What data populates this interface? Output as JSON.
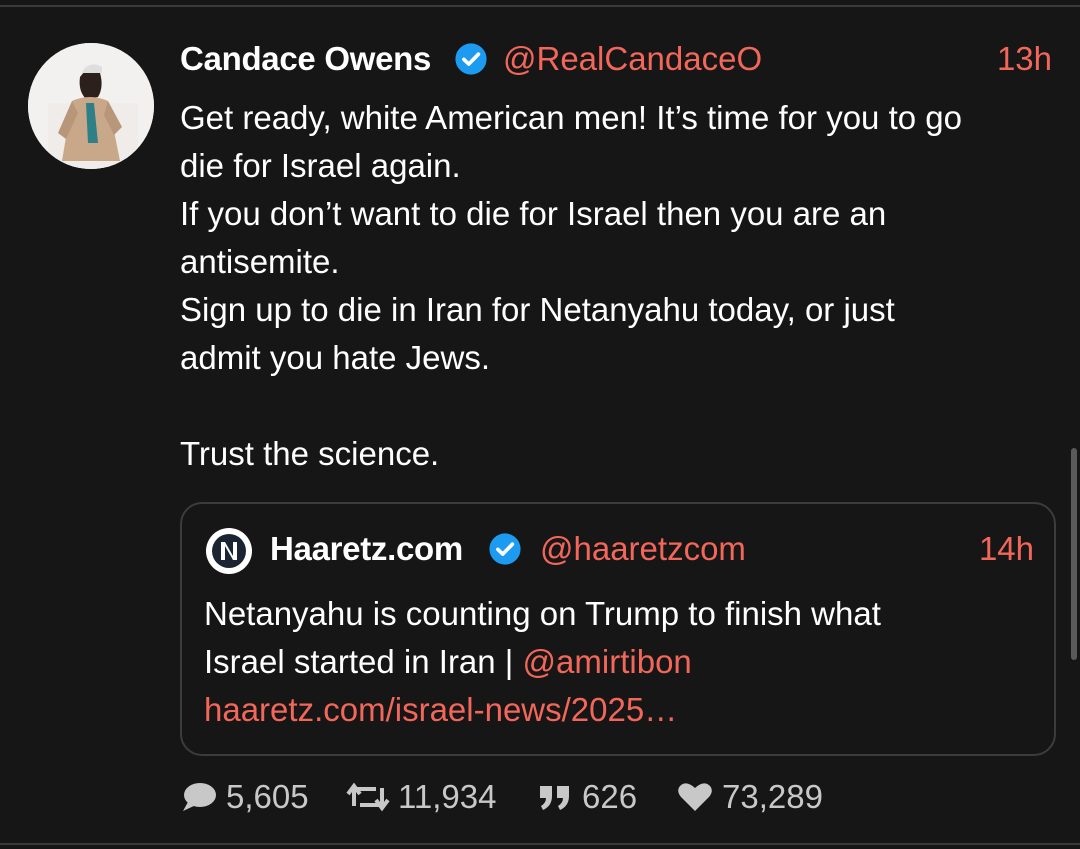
{
  "tweet": {
    "author_name": "Candace Owens",
    "handle": "@RealCandaceO",
    "time": "13h",
    "lines": [
      "Get ready, white American men! It’s time for you to go",
      "die for Israel again.",
      "If you don’t want to die for Israel then you are an",
      "antisemite.",
      "Sign up to die in Iran for Netanyahu today, or just",
      "admit you hate Jews.",
      "",
      "Trust the science."
    ]
  },
  "quote": {
    "author_name": "Haaretz.com",
    "handle": "@haaretzcom",
    "time": "14h",
    "line1": "Netanyahu is counting on Trump to finish what",
    "line2_text": "Israel started in Iran | ",
    "line2_mention": "@amirtibon",
    "link": "haaretz.com/israel-news/2025…"
  },
  "stats": {
    "replies": "5,605",
    "retweets": "11,934",
    "quotes": "626",
    "likes": "73,289"
  },
  "colors": {
    "background": "#161616",
    "accent": "#f2675a",
    "verified": "#1d9bf0",
    "muted": "#c8c8c8"
  },
  "icons": [
    "verified-badge-icon",
    "reply-bubble-icon",
    "retweet-icon",
    "quote-icon",
    "heart-icon"
  ]
}
